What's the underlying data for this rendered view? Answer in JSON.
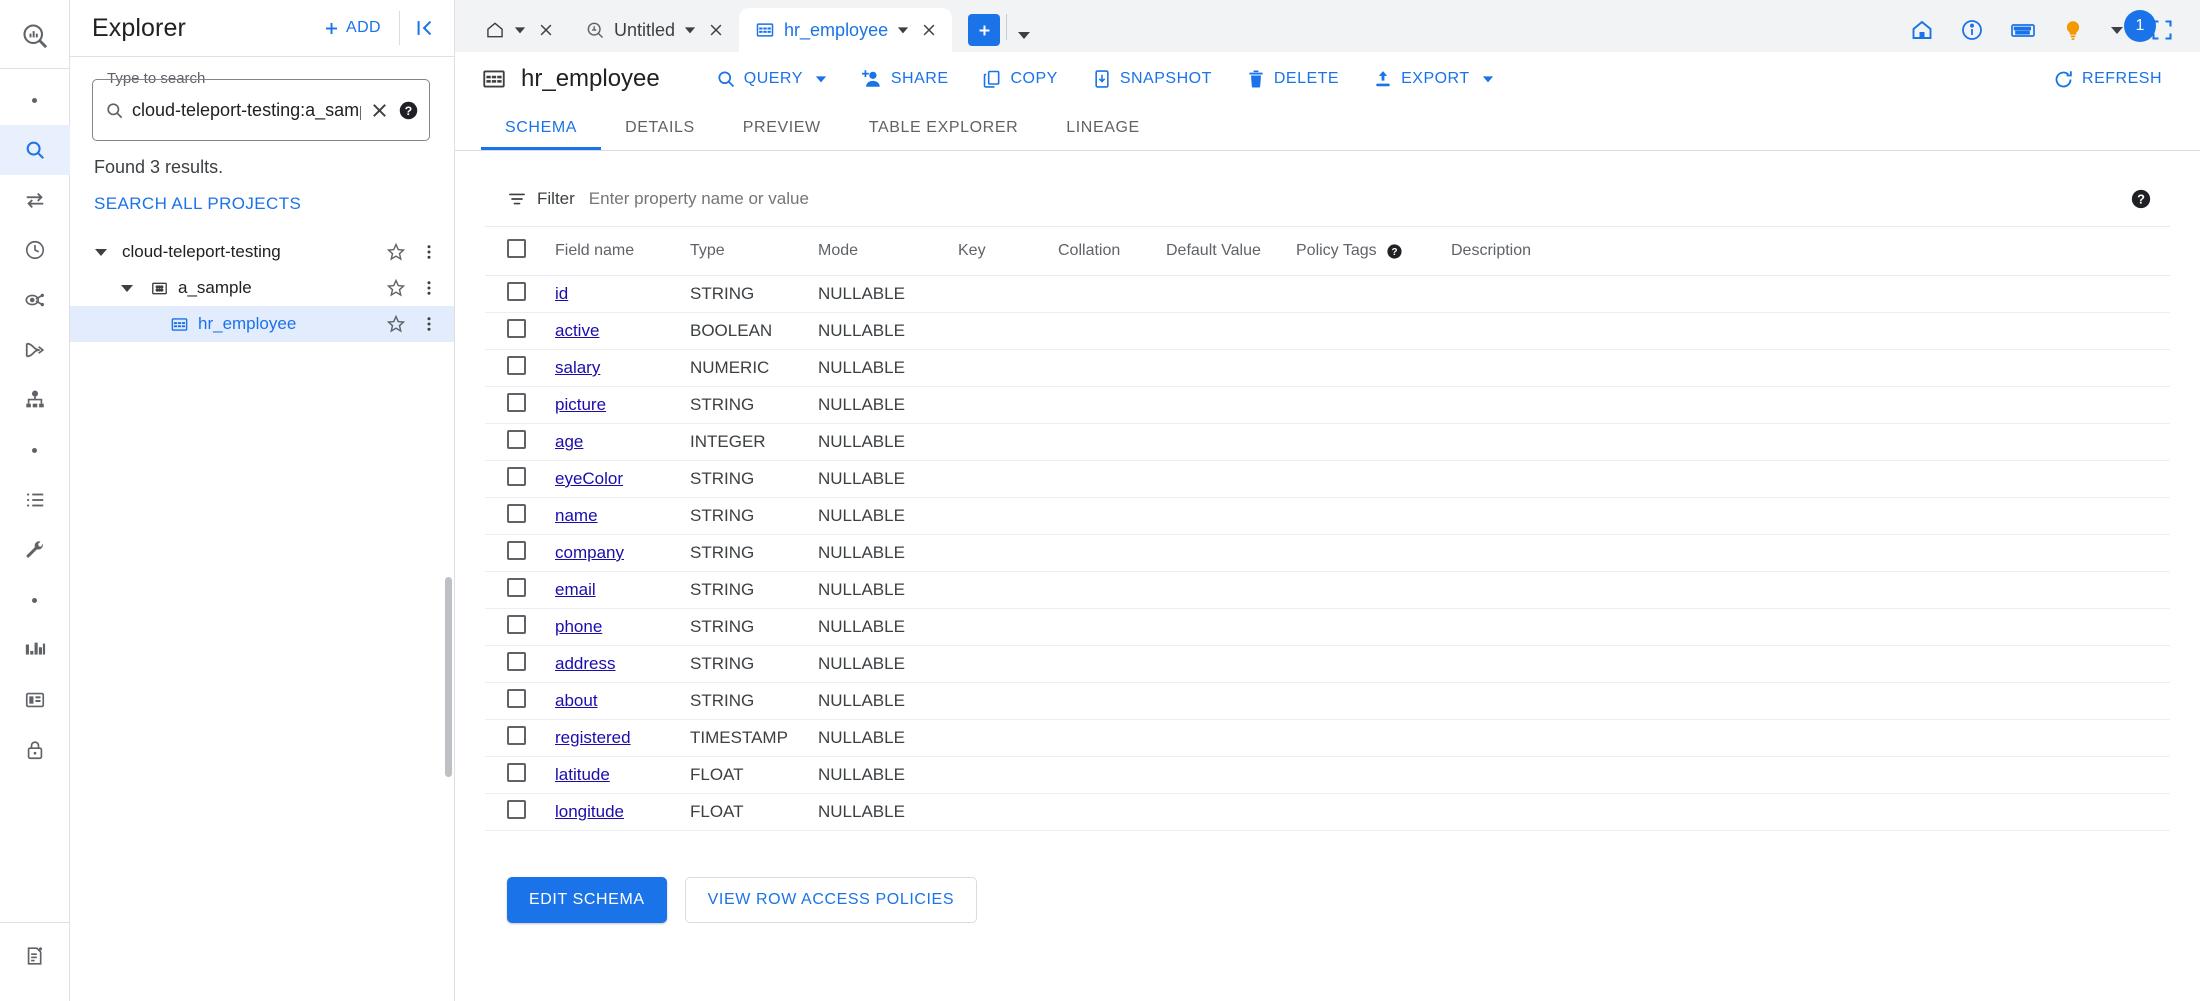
{
  "rail": {
    "logo_icon": "bigquery-logo-icon",
    "items": [
      {
        "name": "dot-item-1",
        "icon": "dot-icon",
        "label": ""
      },
      {
        "name": "search-rail",
        "icon": "search-icon",
        "label": "",
        "active": true
      },
      {
        "name": "transfers-rail",
        "icon": "transfer-arrows-icon",
        "label": ""
      },
      {
        "name": "scheduled-queries-rail",
        "icon": "clock-icon",
        "label": ""
      },
      {
        "name": "analytics-hub-rail",
        "icon": "share-nodes-icon",
        "label": ""
      },
      {
        "name": "pipelines-rail",
        "icon": "dataflow-icon",
        "label": ""
      },
      {
        "name": "dataform-rail",
        "icon": "hierarchy-icon",
        "label": ""
      },
      {
        "name": "dot-item-2",
        "icon": "dot-icon",
        "label": ""
      },
      {
        "name": "job-history-rail",
        "icon": "list-icon",
        "label": ""
      },
      {
        "name": "admin-rail",
        "icon": "wrench-icon",
        "label": ""
      },
      {
        "name": "dot-item-3",
        "icon": "dot-icon",
        "label": ""
      },
      {
        "name": "capacity-rail",
        "icon": "bar-chart-icon",
        "label": ""
      },
      {
        "name": "reservations-rail",
        "icon": "dashboard-icon",
        "label": ""
      },
      {
        "name": "policy-tags-rail",
        "icon": "lock-icon",
        "label": ""
      }
    ],
    "bottom_item": {
      "name": "release-notes-rail",
      "icon": "document-add-icon"
    }
  },
  "explorer": {
    "title": "Explorer",
    "add_label": "ADD",
    "add_icon": "plus-icon",
    "collapse_icon": "collapse-panel-icon",
    "search": {
      "legend": "Type to search",
      "value": "cloud-teleport-testing:a_samp",
      "search_icon": "search-icon",
      "clear_icon": "close-icon",
      "help_icon": "help-circle-icon"
    },
    "results_text": "Found 3 results.",
    "search_all_label": "SEARCH ALL PROJECTS",
    "tree": [
      {
        "label": "cloud-teleport-testing",
        "depth": 0,
        "icon": "",
        "expanded": true,
        "selected": false,
        "star_icon": "star-icon",
        "more_icon": "more-vert-icon"
      },
      {
        "label": "a_sample",
        "depth": 1,
        "icon": "dataset-icon",
        "expanded": true,
        "selected": false,
        "star_icon": "star-icon",
        "more_icon": "more-vert-icon"
      },
      {
        "label": "hr_employee",
        "depth": 2,
        "icon": "table-icon",
        "expanded": false,
        "selected": true,
        "star_icon": "star-icon",
        "more_icon": "more-vert-icon"
      }
    ]
  },
  "tabbar": {
    "tabs": [
      {
        "id": "home",
        "label": "",
        "icon": "home-icon",
        "active": false,
        "has_caret": true,
        "has_close": true
      },
      {
        "id": "untitled",
        "label": "Untitled",
        "icon": "query-icon",
        "active": false,
        "has_caret": true,
        "has_close": true
      },
      {
        "id": "hr_employee",
        "label": "hr_employee",
        "icon": "table-icon",
        "active": true,
        "has_caret": true,
        "has_close": true
      }
    ],
    "new_tab_icon": "plus-icon",
    "new_tab_caret_icon": "chevron-down-icon",
    "right_icons": [
      {
        "name": "home-icon"
      },
      {
        "name": "info-icon"
      },
      {
        "name": "keyboard-icon"
      },
      {
        "name": "lightbulb-icon"
      },
      {
        "name": "chevron-down-icon"
      },
      {
        "name": "fullscreen-icon"
      }
    ],
    "notification_count": "1"
  },
  "table_header": {
    "table_icon": "table-icon",
    "table_name": "hr_employee",
    "actions": [
      {
        "label": "QUERY",
        "icon": "search-icon",
        "caret": true
      },
      {
        "label": "SHARE",
        "icon": "person-add-icon",
        "caret": false
      },
      {
        "label": "COPY",
        "icon": "copy-icon",
        "caret": false
      },
      {
        "label": "SNAPSHOT",
        "icon": "snapshot-icon",
        "caret": false
      },
      {
        "label": "DELETE",
        "icon": "trash-icon",
        "caret": false
      },
      {
        "label": "EXPORT",
        "icon": "export-icon",
        "caret": true
      }
    ],
    "refresh": {
      "label": "REFRESH",
      "icon": "refresh-icon"
    }
  },
  "subtabs": [
    {
      "label": "SCHEMA",
      "active": true
    },
    {
      "label": "DETAILS",
      "active": false
    },
    {
      "label": "PREVIEW",
      "active": false
    },
    {
      "label": "TABLE EXPLORER",
      "active": false
    },
    {
      "label": "LINEAGE",
      "active": false
    }
  ],
  "filter": {
    "label": "Filter",
    "icon": "filter-icon",
    "placeholder": "Enter property name or value",
    "value": "",
    "help_icon": "help-circle-icon"
  },
  "schema": {
    "columns": [
      "Field name",
      "Type",
      "Mode",
      "Key",
      "Collation",
      "Default Value",
      "Policy Tags",
      "Description"
    ],
    "policy_tags_help_icon": "help-circle-icon",
    "select_all_checkbox": "checkbox-icon",
    "rows": [
      {
        "field": "id",
        "type": "STRING",
        "mode": "NULLABLE",
        "key": "",
        "collation": "",
        "default": "",
        "policy": "",
        "description": ""
      },
      {
        "field": "active",
        "type": "BOOLEAN",
        "mode": "NULLABLE",
        "key": "",
        "collation": "",
        "default": "",
        "policy": "",
        "description": ""
      },
      {
        "field": "salary",
        "type": "NUMERIC",
        "mode": "NULLABLE",
        "key": "",
        "collation": "",
        "default": "",
        "policy": "",
        "description": ""
      },
      {
        "field": "picture",
        "type": "STRING",
        "mode": "NULLABLE",
        "key": "",
        "collation": "",
        "default": "",
        "policy": "",
        "description": ""
      },
      {
        "field": "age",
        "type": "INTEGER",
        "mode": "NULLABLE",
        "key": "",
        "collation": "",
        "default": "",
        "policy": "",
        "description": ""
      },
      {
        "field": "eyeColor",
        "type": "STRING",
        "mode": "NULLABLE",
        "key": "",
        "collation": "",
        "default": "",
        "policy": "",
        "description": ""
      },
      {
        "field": "name",
        "type": "STRING",
        "mode": "NULLABLE",
        "key": "",
        "collation": "",
        "default": "",
        "policy": "",
        "description": ""
      },
      {
        "field": "company",
        "type": "STRING",
        "mode": "NULLABLE",
        "key": "",
        "collation": "",
        "default": "",
        "policy": "",
        "description": ""
      },
      {
        "field": "email",
        "type": "STRING",
        "mode": "NULLABLE",
        "key": "",
        "collation": "",
        "default": "",
        "policy": "",
        "description": ""
      },
      {
        "field": "phone",
        "type": "STRING",
        "mode": "NULLABLE",
        "key": "",
        "collation": "",
        "default": "",
        "policy": "",
        "description": ""
      },
      {
        "field": "address",
        "type": "STRING",
        "mode": "NULLABLE",
        "key": "",
        "collation": "",
        "default": "",
        "policy": "",
        "description": ""
      },
      {
        "field": "about",
        "type": "STRING",
        "mode": "NULLABLE",
        "key": "",
        "collation": "",
        "default": "",
        "policy": "",
        "description": ""
      },
      {
        "field": "registered",
        "type": "TIMESTAMP",
        "mode": "NULLABLE",
        "key": "",
        "collation": "",
        "default": "",
        "policy": "",
        "description": ""
      },
      {
        "field": "latitude",
        "type": "FLOAT",
        "mode": "NULLABLE",
        "key": "",
        "collation": "",
        "default": "",
        "policy": "",
        "description": ""
      },
      {
        "field": "longitude",
        "type": "FLOAT",
        "mode": "NULLABLE",
        "key": "",
        "collation": "",
        "default": "",
        "policy": "",
        "description": ""
      }
    ]
  },
  "bottom_actions": {
    "edit_schema_label": "EDIT SCHEMA",
    "view_policies_label": "VIEW ROW ACCESS POLICIES"
  },
  "colors": {
    "accent": "#1a73e8",
    "link": "#1a0dab",
    "selected_row_bg": "#e3ecfd",
    "tabbar_bg": "#f1f3f4",
    "muted_text": "#5f6368"
  }
}
